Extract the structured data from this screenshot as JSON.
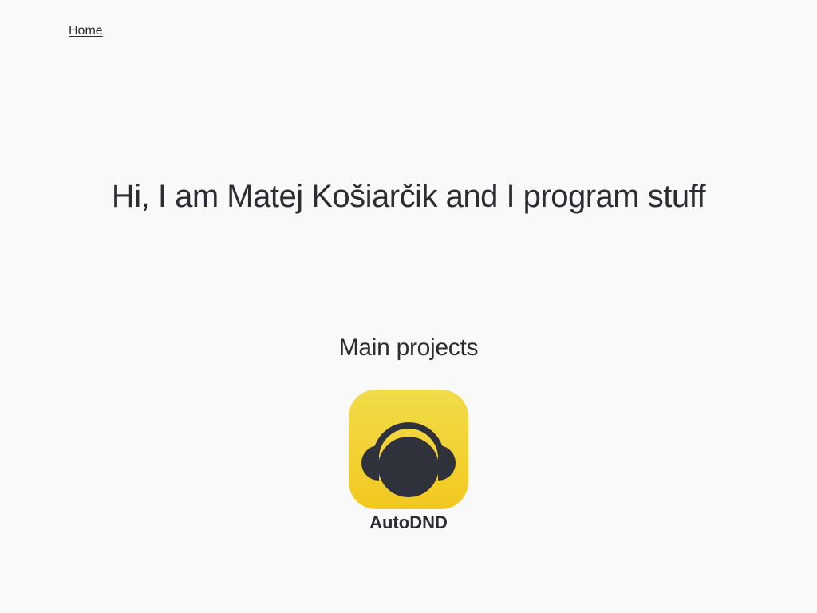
{
  "nav": {
    "home_label": "Home"
  },
  "hero": {
    "title": "Hi, I am Matej Košiarčik and I program stuff"
  },
  "projects_section": {
    "title": "Main projects",
    "items": [
      {
        "name": "AutoDND",
        "icon": "headphones-icon"
      }
    ]
  },
  "colors": {
    "background": "#f9f9f9",
    "text": "#2b2d33",
    "icon_yellow_top": "#f2dc4a",
    "icon_yellow_bottom": "#f2c81f",
    "icon_dark": "#2f323b"
  }
}
